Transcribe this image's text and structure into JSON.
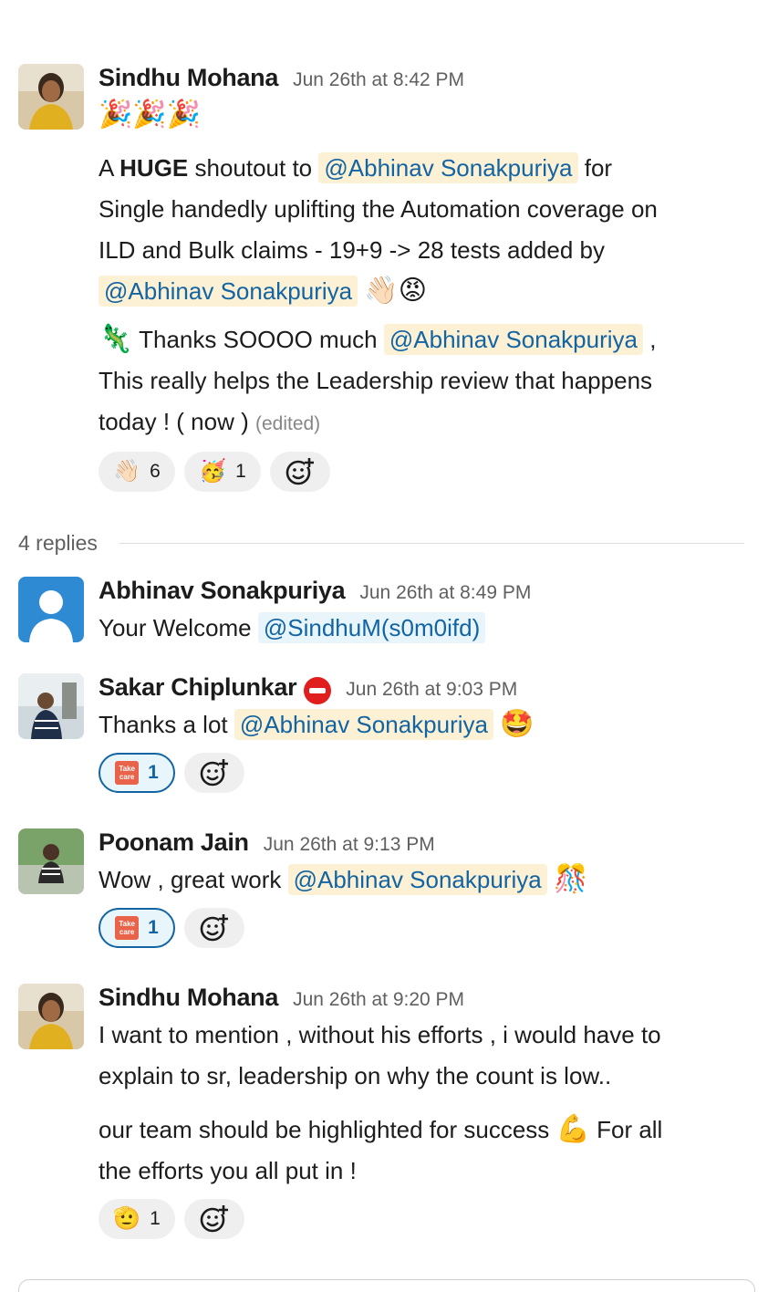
{
  "thread": {
    "parent": {
      "author": "Sindhu Mohana",
      "time": "Jun 26th at 8:42 PM",
      "emoji_line": "🎉🎉🎉",
      "p1_prefix": "A ",
      "p1_bold": "HUGE",
      "p1_mid": " shoutout to ",
      "mention": "@Abhinav Sonakpuriya",
      "p1_after": " for",
      "p1_line2": "Single handedly uplifting the Automation coverage on",
      "p1_line3": "ILD and Bulk claims - 19+9 -> 28 tests added by",
      "p1_emojis": "👋🏻😡",
      "p2_emoji": "🦎",
      "p2_text": " Thanks SOOOO much ",
      "p2_after": " ,",
      "p2_line2": "This really helps the Leadership review that happens",
      "p2_line3": "today ! ( now ) ",
      "edited": "(edited)",
      "reactions": [
        {
          "emoji": "👋🏻",
          "count": "6"
        },
        {
          "emoji": "🥳",
          "count": "1"
        }
      ]
    },
    "replies_label": "4 replies",
    "replies": [
      {
        "author": "Abhinav Sonakpuriya",
        "time": "Jun 26th at 8:49 PM",
        "text": "Your Welcome ",
        "mention": "@SindhuM(s0m0ifd)"
      },
      {
        "author": "Sakar Chiplunkar",
        "time": "Jun 26th at 9:03 PM",
        "text": "Thanks a lot ",
        "mention": "@Abhinav Sonakpuriya",
        "emoji": "🤩",
        "reaction_count": "1",
        "reaction_label": "Take care"
      },
      {
        "author": "Poonam Jain",
        "time": "Jun 26th at 9:13 PM",
        "text": "Wow , great work ",
        "mention": "@Abhinav Sonakpuriya",
        "emoji": "🎊",
        "reaction_count": "1",
        "reaction_label": "Take care"
      },
      {
        "author": "Sindhu Mohana",
        "time": "Jun 26th at 9:20 PM",
        "line1": "I want to mention , without his efforts , i would have to",
        "line2": "explain to sr, leadership on why the count is low..",
        "line3_pre": "our team should be highlighted for success ",
        "line3_emoji": "💪",
        "line3_post": " For all",
        "line4": "the efforts you all put in !",
        "reaction_emoji": "🫡",
        "reaction_count": "1"
      }
    ]
  },
  "icons": {
    "add_reaction": "add-reaction-icon",
    "status": "stop-sign-icon"
  },
  "colors": {
    "mention_text": "#1264a3",
    "mention_bg": "#fdf1d5",
    "active_reaction_border": "#1264a3"
  }
}
